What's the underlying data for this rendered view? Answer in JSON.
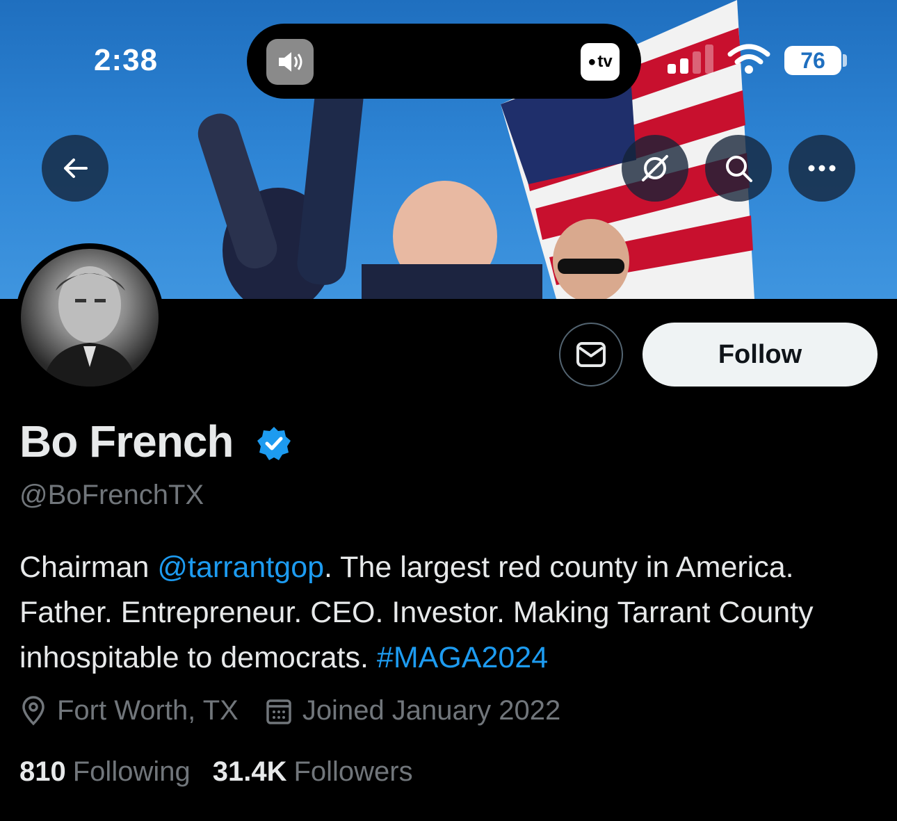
{
  "status_bar": {
    "time": "2:38",
    "tv_label": "tv",
    "battery": "76"
  },
  "nav": {
    "back_icon": "arrow-left-icon",
    "grok_icon": "slashed-circle-icon",
    "search_icon": "search-icon",
    "more_icon": "more-horizontal-icon"
  },
  "profile": {
    "name": "Bo French",
    "handle": "@BoFrenchTX",
    "bio_prefix": "Chairman ",
    "bio_mention": "@tarrantgop",
    "bio_middle": ". The largest red county in America. Father. Entrepreneur. CEO. Investor. Making Tarrant County inhospitable to democrats. ",
    "bio_hashtag": "#MAGA2024",
    "location": "Fort Worth, TX",
    "joined": "Joined January 2022",
    "following_count": "810",
    "following_label": "Following",
    "followers_count": "31.4K",
    "followers_label": "Followers"
  },
  "actions": {
    "follow_label": "Follow"
  },
  "colors": {
    "accent": "#1d9bf0",
    "muted": "#71767b",
    "text": "#e7e9ea",
    "background": "#000000"
  }
}
